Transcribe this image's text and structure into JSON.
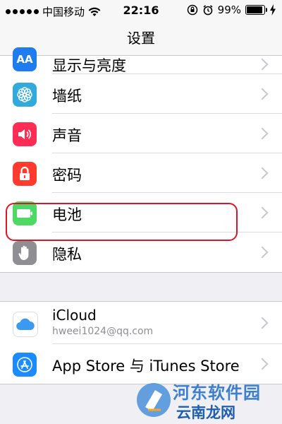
{
  "status_bar": {
    "carrier": "中国移动",
    "time": "22:16",
    "battery_percent": "99%",
    "battery_level": 0.99
  },
  "nav": {
    "title": "设置"
  },
  "group1": {
    "items": [
      {
        "label": "显示与亮度",
        "icon": "display-brightness-icon",
        "icon_text": "AA",
        "color": "#1e7cf0"
      },
      {
        "label": "墙纸",
        "icon": "wallpaper-flower-icon",
        "color": "#33aadc"
      },
      {
        "label": "声音",
        "icon": "speaker-icon",
        "color": "#ff2d55"
      },
      {
        "label": "密码",
        "icon": "lock-icon",
        "color": "#ff3b30"
      },
      {
        "label": "电池",
        "icon": "battery-icon",
        "color": "#4cd964"
      },
      {
        "label": "隐私",
        "icon": "hand-icon",
        "color": "#8e8e93"
      }
    ]
  },
  "group2": {
    "items": [
      {
        "label": "iCloud",
        "sublabel": "hweei1024@qq.com",
        "icon": "icloud-icon",
        "color": "#ffffff"
      },
      {
        "label": "App Store 与 iTunes Store",
        "icon": "app-store-icon",
        "color": "#1a8cff"
      }
    ]
  },
  "watermark": {
    "line1": "河东软件园",
    "line2": "云南龙网"
  },
  "colors": {
    "highlight": "#d9162b",
    "background": "#efeff4"
  }
}
